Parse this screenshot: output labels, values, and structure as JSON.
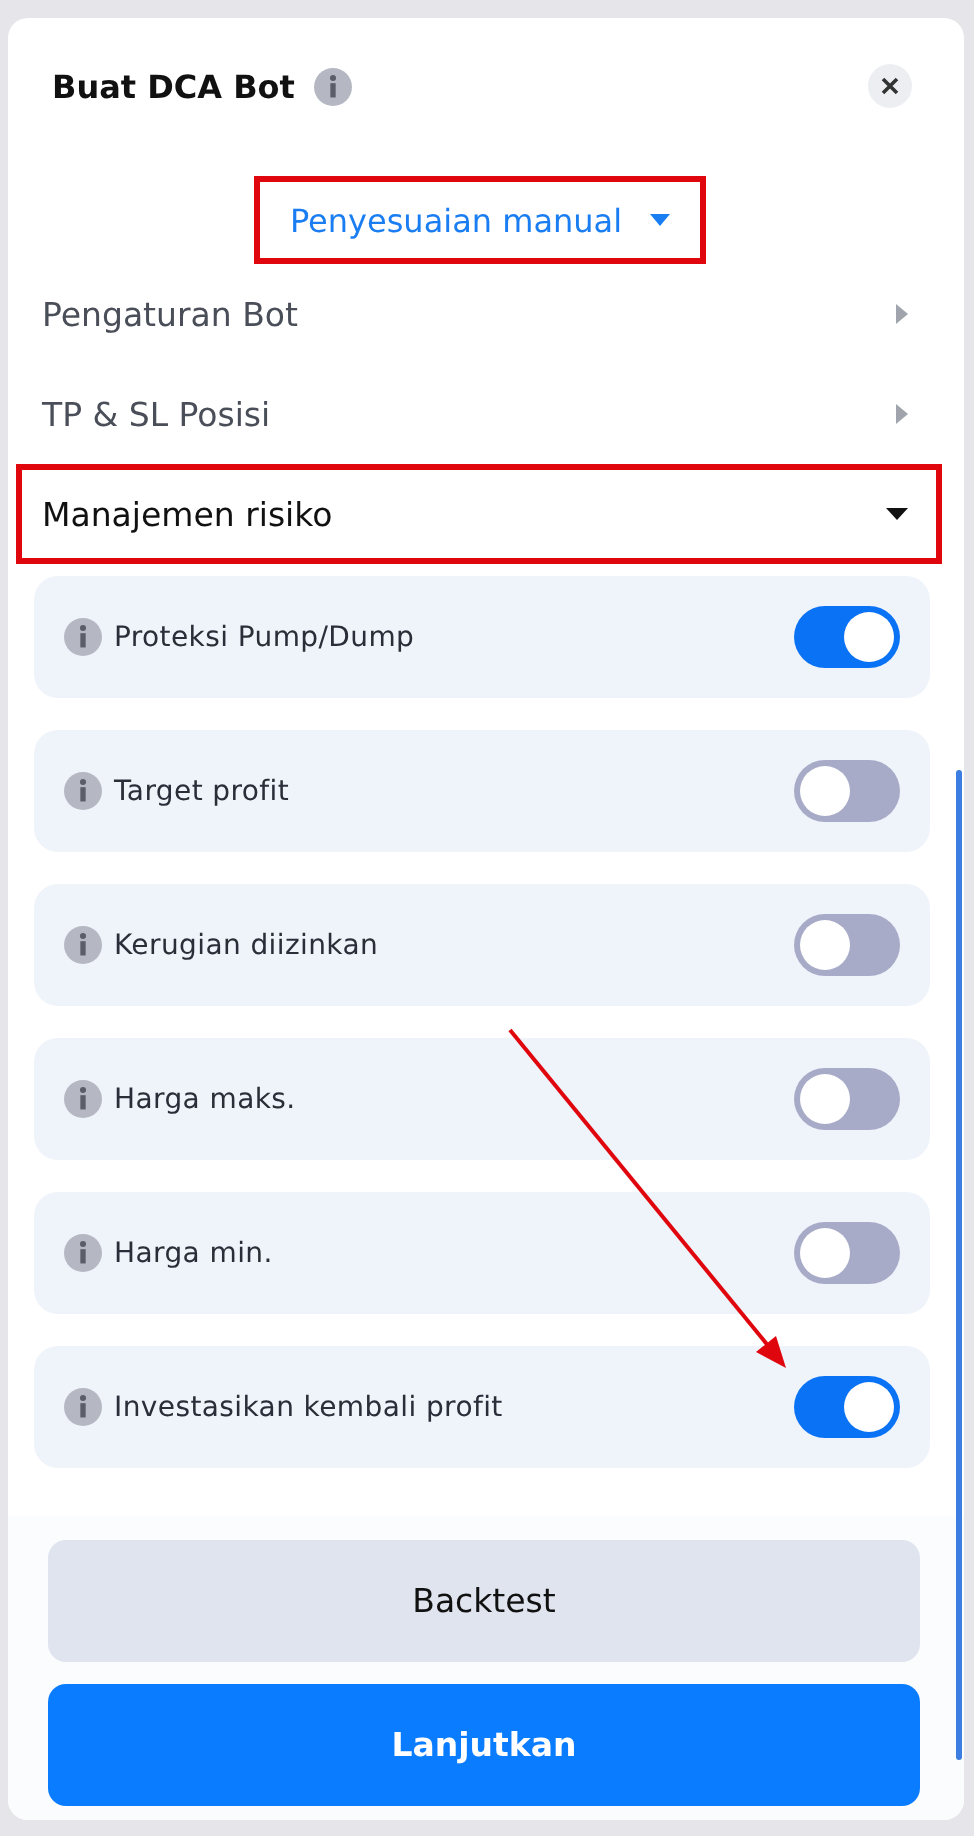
{
  "header": {
    "title": "Buat DCA Bot"
  },
  "mode_dropdown": {
    "label": "Penyesuaian manual",
    "highlighted": true
  },
  "sections": [
    {
      "label": "Pengaturan Bot",
      "expanded": false,
      "highlighted": false
    },
    {
      "label": "TP & SL Posisi",
      "expanded": false,
      "highlighted": false
    },
    {
      "label": "Manajemen risiko",
      "expanded": true,
      "highlighted": true
    }
  ],
  "risk_settings": [
    {
      "label": "Proteksi Pump/Dump",
      "on": true
    },
    {
      "label": "Target profit",
      "on": false
    },
    {
      "label": "Kerugian diizinkan",
      "on": false
    },
    {
      "label": "Harga maks.",
      "on": false
    },
    {
      "label": "Harga min.",
      "on": false
    },
    {
      "label": "Investasikan kembali profit",
      "on": true
    }
  ],
  "buttons": [
    {
      "label": "Backtest",
      "kind": "secondary"
    },
    {
      "label": "Lanjutkan",
      "kind": "primary"
    }
  ]
}
